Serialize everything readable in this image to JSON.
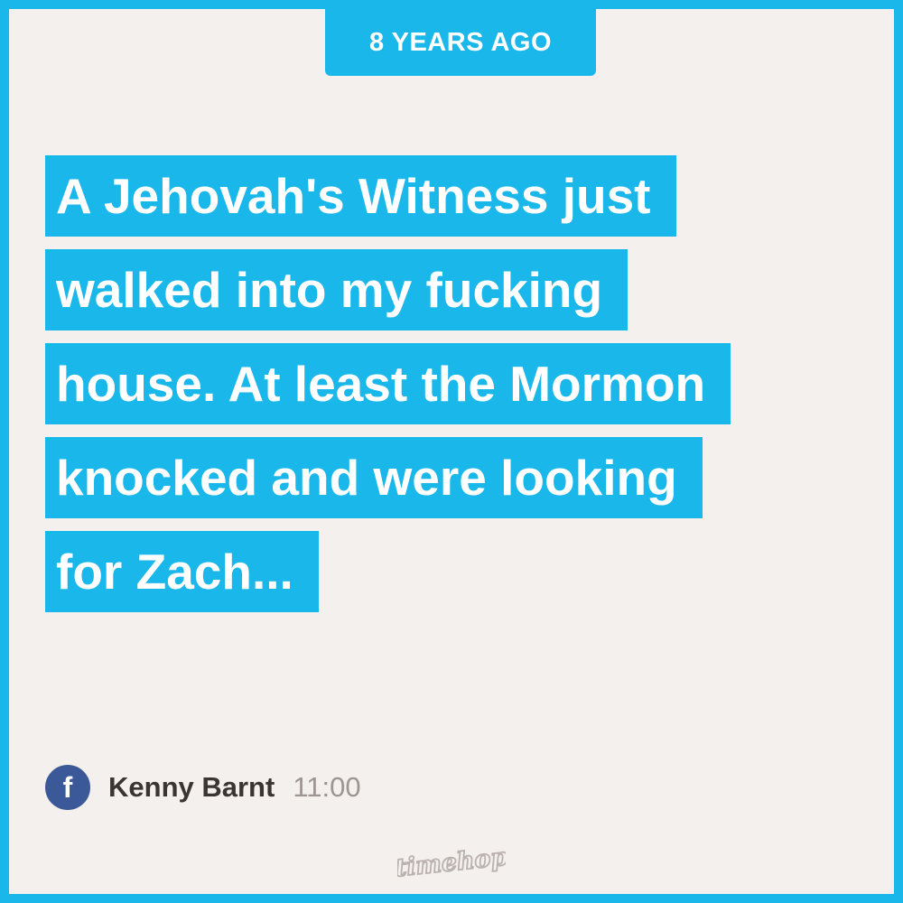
{
  "header": {
    "years_ago_label": "8 YEARS AGO"
  },
  "post": {
    "lines": [
      "A Jehovah's Witness just",
      "walked into my fucking",
      "house. At least the Mormon",
      "knocked and were looking",
      "for Zach..."
    ]
  },
  "author": {
    "source_icon": "facebook-icon",
    "source_icon_glyph": "f",
    "name": "Kenny Barnt",
    "time": "11:00"
  },
  "footer": {
    "logo_text": "timehop"
  },
  "colors": {
    "accent": "#1ab7ea",
    "card_background": "#f4f0ee",
    "facebook_blue": "#3b5998",
    "name_text": "#3a3432",
    "time_text": "#9c9592",
    "logo_color": "#b9b2ae"
  }
}
